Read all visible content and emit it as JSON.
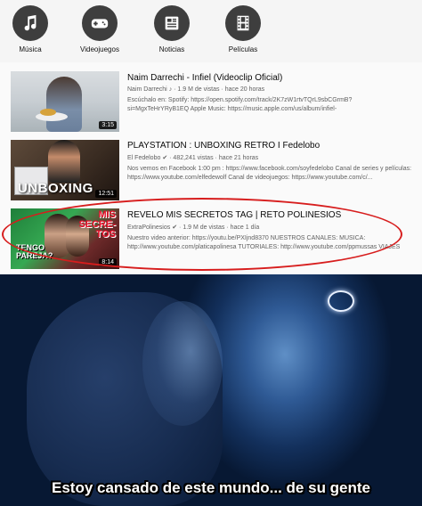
{
  "categories": [
    {
      "label": "Música",
      "icon": "music-note-icon"
    },
    {
      "label": "Videojuegos",
      "icon": "gamepad-icon"
    },
    {
      "label": "Noticias",
      "icon": "newspaper-icon"
    },
    {
      "label": "Películas",
      "icon": "film-strip-icon"
    }
  ],
  "videos": [
    {
      "title": "Naim Darrechi - Infiel (Videoclip Oficial)",
      "channel": "Naim Darrechi",
      "verified": "♪",
      "views": "1.9 M de vistas",
      "age": "hace 20 horas",
      "desc1": "Escúchalo en: Spotify: https://open.spotify.com/track/2K7zW1rtvTQrL9sbCGrmB?",
      "desc2": "si=MgxTeHrYRyB1EQ Apple Music: https://music.apple.com/us/album/infiel-",
      "duration": "3:15"
    },
    {
      "title": "PLAYSTATION : UNBOXING RETRO I Fedelobo",
      "channel": "El Fedelobo",
      "verified": "✔",
      "views": "482,241 vistas",
      "age": "hace 21 horas",
      "desc1": "Nos vemos en Facebook 1:00 pm : https://www.facebook.com/soyfedelobo Canal de series y películas:",
      "desc2": "https://www.youtube.com/elfedewolf Canal de videojuegos: https://www.youtube.com/c/...",
      "duration": "12:51",
      "thumb_text": "UNBOXING"
    },
    {
      "title": "REVELO MIS SECRETOS TAG | RETO POLINESIOS",
      "channel": "ExtraPolinesios",
      "verified": "✔",
      "views": "1.9 M de vistas",
      "age": "hace 1 día",
      "desc1": "Nuestro video anterior: https://youtu.be/PXIjnd8370 NUESTROS CANALES: MUSICA:",
      "desc2": "http://www.youtube.com/platicapolinesa TUTORIALES: http://www.youtube.com/ppmussas VIAJES",
      "duration": "8:14",
      "thumb_text1": "MIS",
      "thumb_text2": "SECRE-",
      "thumb_text3": "TOS",
      "thumb_text4": "TENGO",
      "thumb_text5": "PAREJA?"
    }
  ],
  "meme": {
    "caption": "Estoy cansado de este mundo... de su gente"
  }
}
